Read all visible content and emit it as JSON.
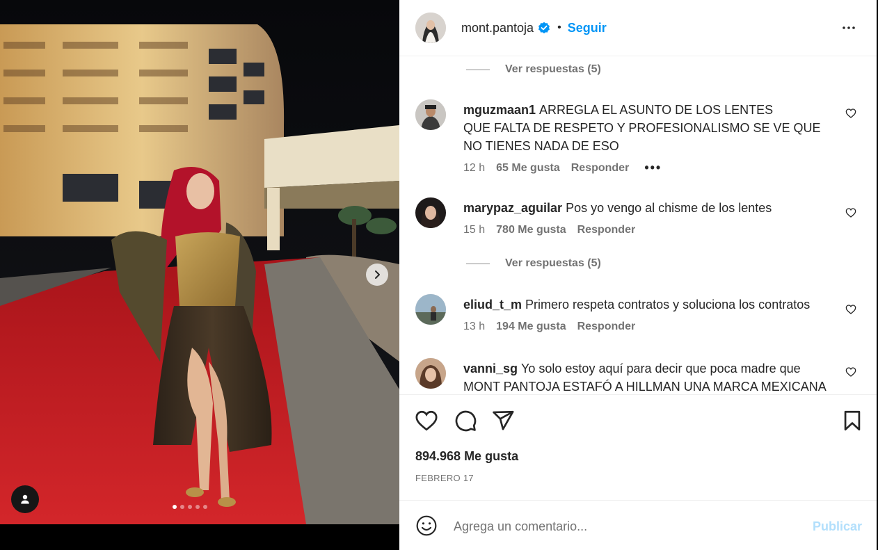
{
  "post": {
    "username": "mont.pantoja",
    "separator": "•",
    "follow_label": "Seguir",
    "more_icon": "more-horizontal-icon",
    "carousel": {
      "slide_count": 5,
      "active_slide": 1
    }
  },
  "comments": {
    "view_replies_top": "Ver respuestas (5)",
    "view_replies_mid": "Ver respuestas (5)",
    "items": [
      {
        "user": "mguzmaan1",
        "text_line1": "ARREGLA EL ASUNTO DE LOS LENTES",
        "text_line2": "QUE FALTA DE RESPETO Y PROFESIONALISMO SE VE QUE NO TIENES NADA DE ESO",
        "time": "12 h",
        "likes": "65 Me gusta",
        "reply": "Responder",
        "options": "•••"
      },
      {
        "user": "marypaz_aguilar",
        "text_line1": "Pos yo vengo al chisme de los lentes",
        "time": "15 h",
        "likes": "780 Me gusta",
        "reply": "Responder"
      },
      {
        "user": "eliud_t_m",
        "text_line1": "Primero respeta contratos y soluciona los contratos",
        "time": "13 h",
        "likes": "194 Me gusta",
        "reply": "Responder"
      },
      {
        "user": "vanni_sg",
        "text_line1": "Yo solo estoy aquí para decir que poca madre que",
        "text_line2": "MONT PANTOJA ESTAFÓ A HILLMAN UNA MARCA MEXICANA"
      }
    ]
  },
  "actions": {
    "likes_total": "894.968 Me gusta",
    "date": "FEBRERO 17"
  },
  "composer": {
    "placeholder": "Agrega un comentario...",
    "publish_label": "Publicar"
  },
  "colors": {
    "accent": "#0095f6",
    "publish_disabled": "#b2dffc",
    "secondary_text": "#737373",
    "border": "#efefef"
  }
}
